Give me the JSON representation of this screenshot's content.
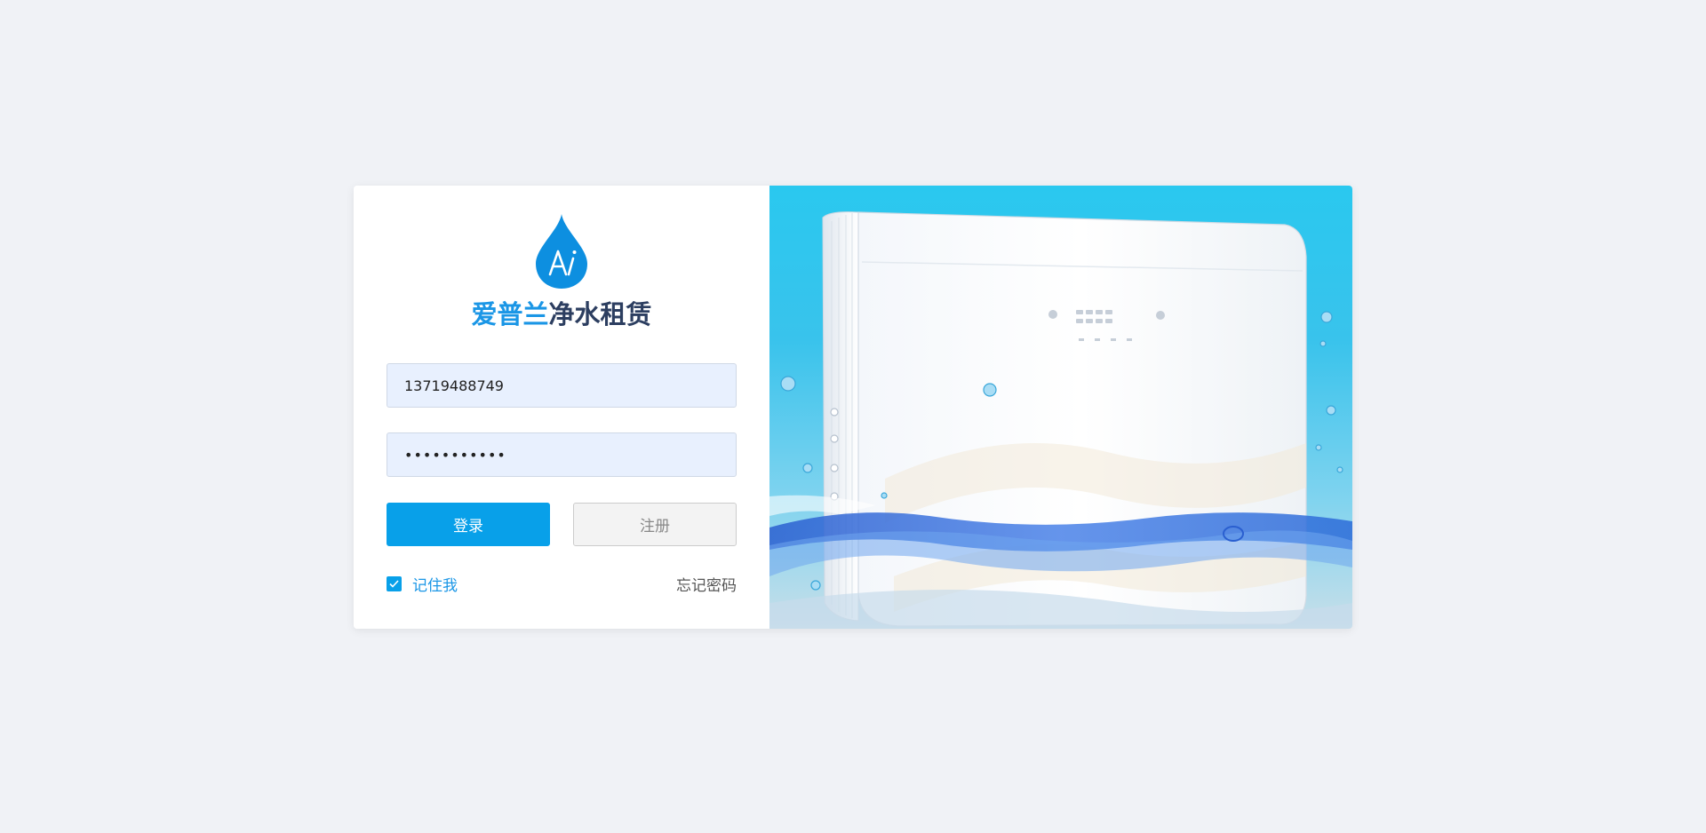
{
  "brand": {
    "part1": "爱普兰",
    "part2": "净水租赁",
    "logo_text": "Ai",
    "logo_icon": "water-drop-icon",
    "accent_color": "#1a96e6",
    "dark_color": "#2c3e60"
  },
  "form": {
    "username_value": "13719488749",
    "password_value": "•••••••••••",
    "login_label": "登录",
    "register_label": "注册",
    "remember_label": "记住我",
    "remember_checked": true,
    "forgot_label": "忘记密码"
  },
  "colors": {
    "primary": "#08a0e9",
    "page_bg": "#f0f2f6",
    "input_bg": "#e8f0fe"
  },
  "hero": {
    "image": "water-purifier-product-image"
  }
}
